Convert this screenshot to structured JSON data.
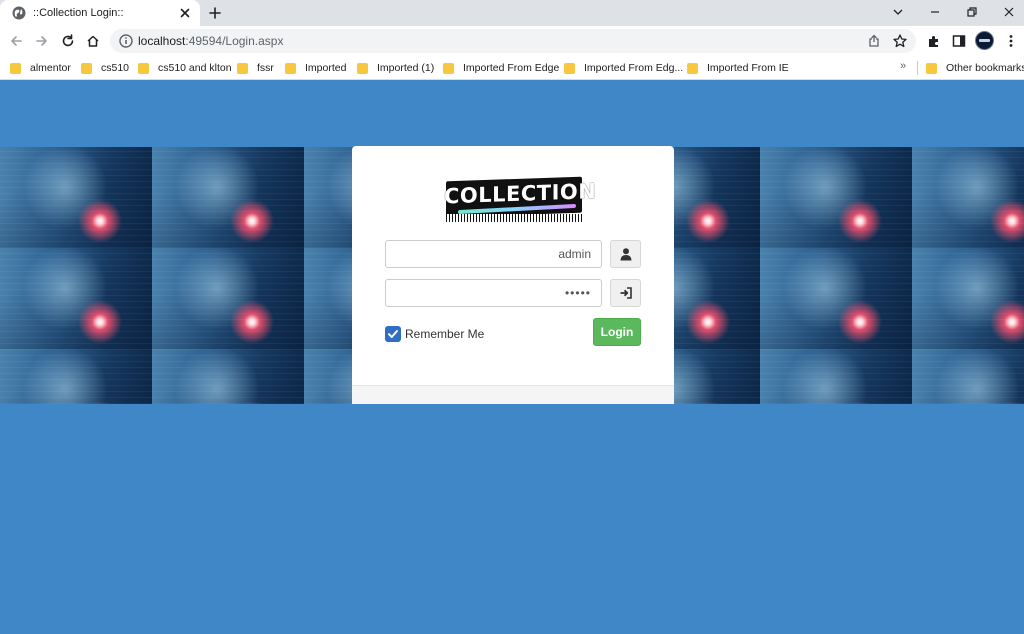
{
  "browser": {
    "tab": {
      "title": "::Collection Login::",
      "favicon": "globe-icon"
    },
    "address": {
      "host": "localhost",
      "path": ":49594/Login.aspx"
    },
    "bookmarks": [
      {
        "label": "almentor"
      },
      {
        "label": "cs510"
      },
      {
        "label": "cs510 and klton"
      },
      {
        "label": "fssr"
      },
      {
        "label": "Imported"
      },
      {
        "label": "Imported (1)"
      },
      {
        "label": "Imported From Edge"
      },
      {
        "label": "Imported From Edg..."
      },
      {
        "label": "Imported From IE"
      }
    ],
    "more_bookmarks": "»",
    "other_bookmarks": "Other bookmarks"
  },
  "login": {
    "logo_text": "COLLECTION",
    "username_value": "admin",
    "password_value": "•••••",
    "remember_label": "Remember Me",
    "remember_checked": true,
    "login_label": "Login"
  },
  "colors": {
    "page_background": "#3f87c6",
    "login_button": "#5cb85c",
    "checkbox": "#2f6fc3"
  }
}
